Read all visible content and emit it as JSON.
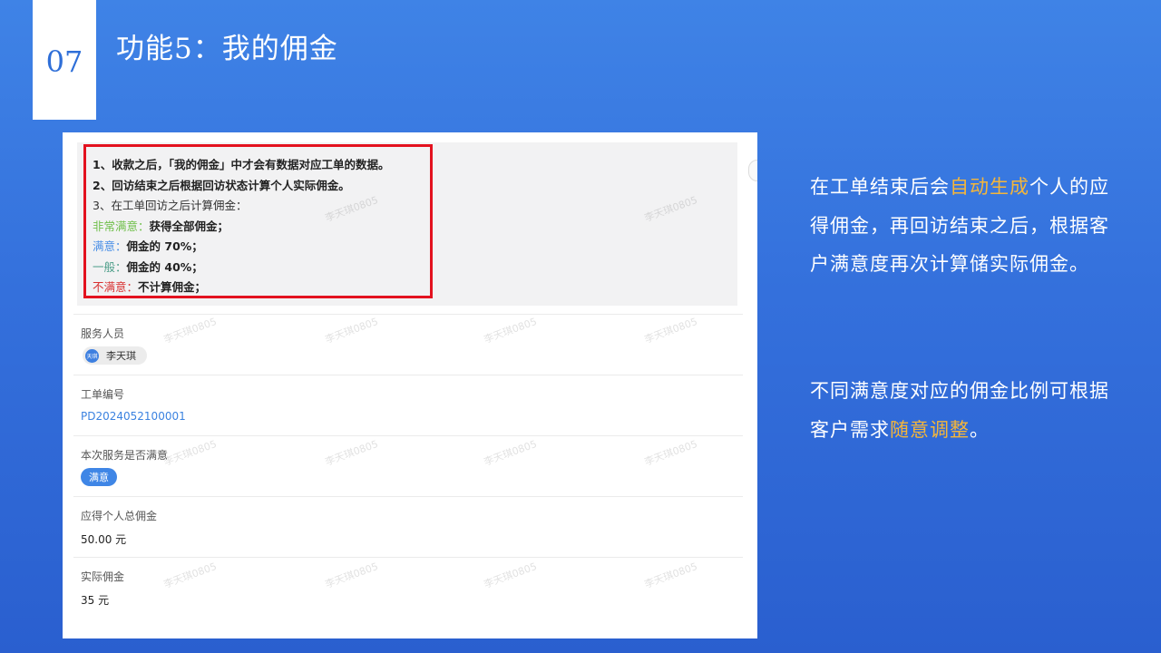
{
  "slide": {
    "number": "07",
    "title": "功能5：我的佣金"
  },
  "notice": {
    "line1": "1、收款之后，「我的佣金」中才会有数据对应工单的数据。",
    "line2": "2、回访结束之后根据回访状态计算个人实际佣金。",
    "line3": "3、在工单回访之后计算佣金：",
    "rules": [
      {
        "level": "非常满意：",
        "text": "获得全部佣金；",
        "color": "#6fbf4a"
      },
      {
        "level": "满意：",
        "text": "佣金的 70%；",
        "color": "#4a8fe6"
      },
      {
        "level": "一般：",
        "text": "佣金的 40%；",
        "color": "#4f9f8a"
      },
      {
        "level": "不满意：",
        "text": "不计算佣金；",
        "color": "#d83131"
      }
    ]
  },
  "fields": {
    "service_person": {
      "label": "服务人员",
      "avatar_text": "天琪",
      "name": "李天琪"
    },
    "order_no": {
      "label": "工单编号",
      "value": "PD2024052100001"
    },
    "satisfaction": {
      "label": "本次服务是否满意",
      "value": "满意"
    },
    "expected_commission": {
      "label": "应得个人总佣金",
      "value": "50.00 元"
    },
    "actual_commission": {
      "label": "实际佣金",
      "value": "35 元"
    }
  },
  "watermark": "李天琪0805",
  "description": {
    "p1_a": "在工单结束后会",
    "p1_hl": "自动生成",
    "p1_b": "个人的应得佣金，再回访结束之后，根据客户满意度再次计算储实际佣金。",
    "p2_a": "不同满意度对应的佣金比例可根据客户需求",
    "p2_hl": "随意调整",
    "p2_b": "。"
  },
  "colors": {
    "highlight": "#f5b63a",
    "accent_blue": "#3f86e6",
    "alert_red": "#e3121f"
  }
}
